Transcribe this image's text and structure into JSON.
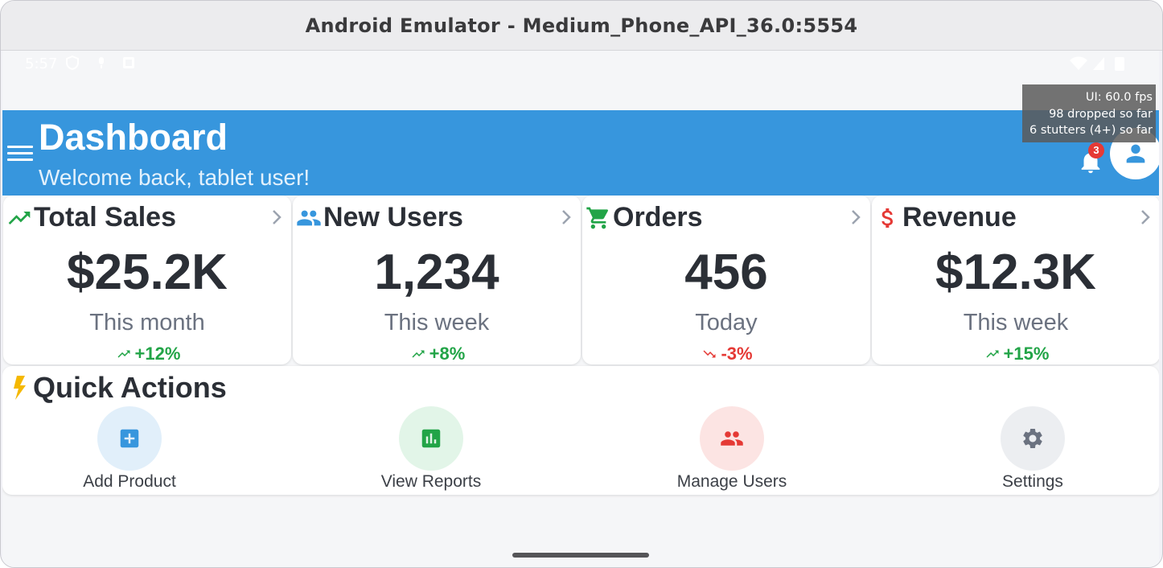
{
  "window": {
    "title": "Android Emulator - Medium_Phone_API_36.0:5554"
  },
  "statusbar": {
    "time": "5:57"
  },
  "fps_overlay": {
    "line1": "UI: 60.0 fps",
    "line2": "98 dropped so far",
    "line3": "6 stutters (4+) so far"
  },
  "header": {
    "title": "Dashboard",
    "subtitle": "Welcome back, tablet user!",
    "notification_count": "3",
    "color": "#3796dd"
  },
  "cards": [
    {
      "title": "Total Sales",
      "value": "$25.2K",
      "period": "This month",
      "change": "+12%",
      "trend": "up",
      "icon": "trending-up-icon",
      "icon_color": "#22a447"
    },
    {
      "title": "New Users",
      "value": "1,234",
      "period": "This week",
      "change": "+8%",
      "trend": "up",
      "icon": "people-icon",
      "icon_color": "#3796dd"
    },
    {
      "title": "Orders",
      "value": "456",
      "period": "Today",
      "change": "-3%",
      "trend": "down",
      "icon": "cart-icon",
      "icon_color": "#22a447"
    },
    {
      "title": "Revenue",
      "value": "$12.3K",
      "period": "This week",
      "change": "+15%",
      "trend": "up",
      "icon": "dollar-icon",
      "icon_color": "#e53935"
    }
  ],
  "quick_actions": {
    "title": "Quick Actions",
    "items": [
      {
        "label": "Add Product",
        "icon": "add-box-icon",
        "color": "#3796dd"
      },
      {
        "label": "View Reports",
        "icon": "bar-chart-icon",
        "color": "#22a447"
      },
      {
        "label": "Manage Users",
        "icon": "people-icon",
        "color": "#e53935"
      },
      {
        "label": "Settings",
        "icon": "gear-icon",
        "color": "#6b7280"
      }
    ]
  },
  "colors": {
    "up": "#22a447",
    "down": "#e53935"
  }
}
